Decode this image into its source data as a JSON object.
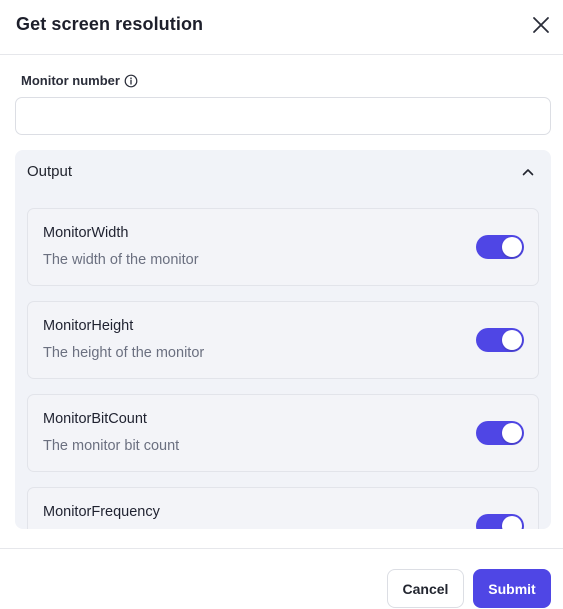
{
  "dialog": {
    "title": "Get screen resolution",
    "close_icon": "close-icon"
  },
  "monitor_field": {
    "label": "Monitor number",
    "info_icon": "info-icon",
    "value": "",
    "placeholder": ""
  },
  "output": {
    "title": "Output",
    "expanded": true,
    "items": [
      {
        "title": "MonitorWidth",
        "description": "The width of the monitor",
        "enabled": true
      },
      {
        "title": "MonitorHeight",
        "description": "The height of the monitor",
        "enabled": true
      },
      {
        "title": "MonitorBitCount",
        "description": "The monitor bit count",
        "enabled": true
      },
      {
        "title": "MonitorFrequency",
        "description": "",
        "enabled": true
      }
    ]
  },
  "footer": {
    "cancel_label": "Cancel",
    "submit_label": "Submit"
  },
  "colors": {
    "accent": "#4f46e5",
    "panel_bg": "#f1f3f8",
    "muted_text": "#6b7080"
  }
}
